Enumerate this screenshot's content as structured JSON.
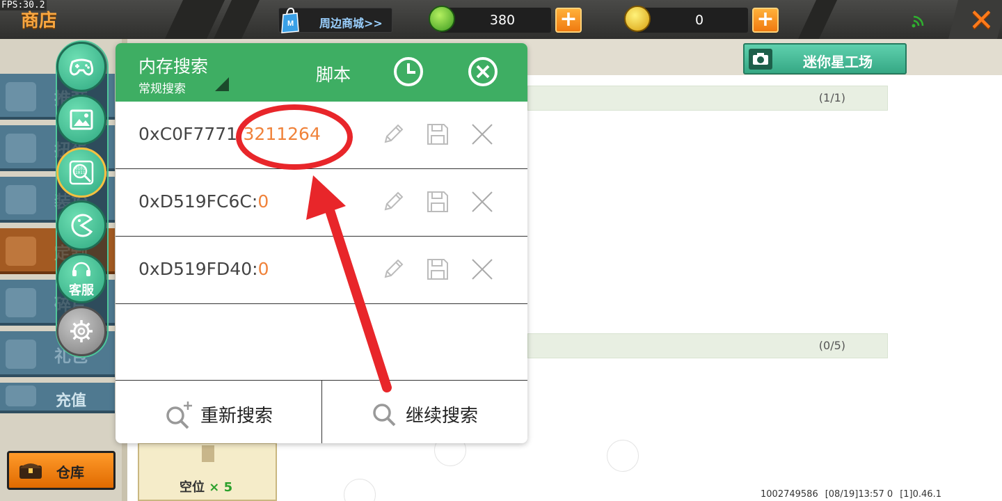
{
  "top_bar": {
    "fps_text": "FPS:30.2",
    "title": "商店",
    "mall_link": "周边商城>>",
    "gems": "380",
    "coins": "0",
    "plus_symbol": "+",
    "close_symbol": "✕",
    "accent_color": "#f8a640"
  },
  "sidebar": {
    "categories": [
      {
        "label": "推荐"
      },
      {
        "label": "扭蛋"
      },
      {
        "label": "装扮"
      },
      {
        "label": "定制"
      },
      {
        "label": "碎片"
      },
      {
        "label": "礼包"
      },
      {
        "label": "充值"
      }
    ],
    "warehouse": "仓库"
  },
  "floating_tools": [
    {
      "icon": "gamepad-icon"
    },
    {
      "icon": "image-icon"
    },
    {
      "icon": "binary-search-icon"
    },
    {
      "icon": "pacman-icon"
    },
    {
      "icon": "headset-icon",
      "label": "客服"
    },
    {
      "icon": "gear-icon"
    }
  ],
  "background_panel": {
    "factory_button": "迷你星工场",
    "section1_count": "(1/1)",
    "section2_count": "(0/5)",
    "slot_label": "空位",
    "slot_count": "× 5",
    "footer": {
      "user_id": "1002749586",
      "datetime": "[08/19]13:57 0",
      "version": "[1]0.46.1"
    }
  },
  "dialog": {
    "title": "内存搜索",
    "mode": "常规搜索",
    "script_tab": "脚本",
    "results": [
      {
        "address": "0xC0F7771",
        "separator": ":",
        "value": "3211264"
      },
      {
        "address": "0xD519FC6C",
        "separator": ":",
        "value": "0"
      },
      {
        "address": "0xD519FD40",
        "separator": ":",
        "value": "0"
      }
    ],
    "research_button": "重新搜索",
    "continue_button": "继续搜索",
    "header_color": "#3eae63",
    "value_color": "#f0823a"
  },
  "annotation": {
    "color": "#e8262a"
  }
}
